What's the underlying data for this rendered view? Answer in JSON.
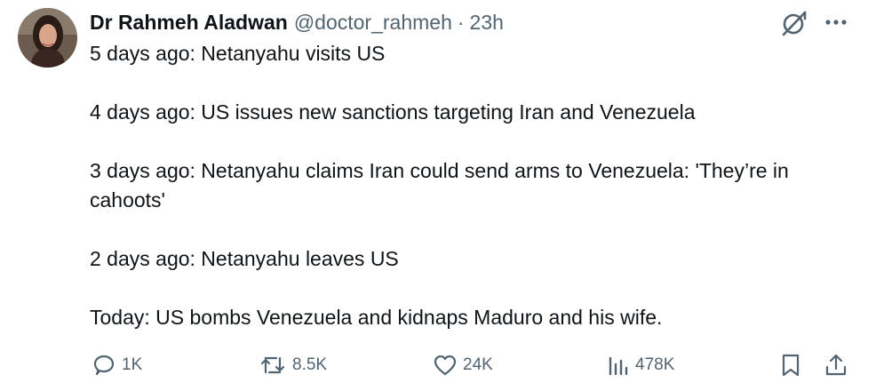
{
  "author": {
    "display_name": "Dr Rahmeh Aladwan",
    "handle": "@doctor_rahmeh",
    "separator": "·",
    "time_ago": "23h"
  },
  "header_icons": [
    "grok-icon",
    "more-options-icon"
  ],
  "tweet": {
    "lines": [
      "5 days ago: Netanyahu visits US",
      "4 days ago: US issues new sanctions targeting Iran and Venezuela",
      "3 days ago: Netanyahu claims Iran could send arms to Venezuela: 'They’re in cahoots'",
      "2 days ago: Netanyahu leaves US",
      "Today: US bombs Venezuela and kidnaps Maduro and his wife."
    ]
  },
  "actions": {
    "replies": "1K",
    "reposts": "8.5K",
    "likes": "24K",
    "views": "478K"
  },
  "action_icons": [
    "reply-icon",
    "repost-icon",
    "like-icon",
    "views-icon",
    "bookmark-icon",
    "share-icon"
  ],
  "colors": {
    "text_primary": "#0f1419",
    "text_secondary": "#536471",
    "background": "#ffffff"
  }
}
